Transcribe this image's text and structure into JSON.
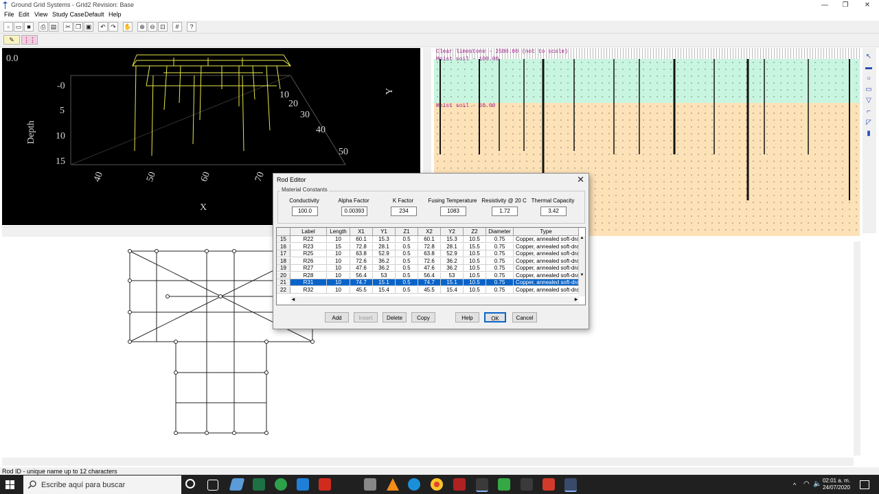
{
  "window": {
    "title": "Ground Grid Systems - Grid2    Revision: Base"
  },
  "menus": [
    "File",
    "Edit",
    "View",
    "Study Case",
    "Default",
    "Help"
  ],
  "view3d": {
    "top_value": "0.0",
    "depth_label": "Depth",
    "depth_ticks": [
      "-0",
      "5",
      "10",
      "15"
    ],
    "x_label": "X",
    "x_ticks": [
      "40",
      "50",
      "60",
      "70"
    ],
    "y_label": "Y",
    "y_ticks": [
      "10",
      "20",
      "30",
      "40",
      "50"
    ]
  },
  "soil": {
    "top_layer": "Clear limestone - 2500.00   (not to scale)",
    "layer1": "Moist soil - 100.00",
    "layer2": "Moist soil - 60.00"
  },
  "status": {
    "text": "Rod ID - unique name up to 12 characters"
  },
  "dialog": {
    "title": "Rod Editor",
    "group_label": "Material Constants",
    "constants": [
      {
        "label": "Conductivity",
        "value": "100.0"
      },
      {
        "label": "Alpha Factor",
        "value": "0.00393"
      },
      {
        "label": "K Factor",
        "value": "234"
      },
      {
        "label": "Fusing Temperature",
        "value": "1083"
      },
      {
        "label": "Resistivity @ 20 C",
        "value": "1.72"
      },
      {
        "label": "Thermal Capacity",
        "value": "3.42"
      }
    ],
    "columns": [
      "Label",
      "Length",
      "X1",
      "Y1",
      "Z1",
      "X2",
      "Y2",
      "Z2",
      "Diameter",
      "Type"
    ],
    "rows": [
      {
        "n": "15",
        "cells": [
          "R22",
          "10",
          "60.1",
          "15.3",
          "0.5",
          "60.1",
          "15.3",
          "10.5",
          "0.75",
          "Copper, annealed soft-drawn"
        ]
      },
      {
        "n": "16",
        "cells": [
          "R23",
          "15",
          "72.8",
          "28.1",
          "0.5",
          "72.8",
          "28.1",
          "15.5",
          "0.75",
          "Copper, annealed soft-drawn"
        ]
      },
      {
        "n": "17",
        "cells": [
          "R25",
          "10",
          "63.8",
          "52.9",
          "0.5",
          "63.8",
          "52.9",
          "10.5",
          "0.75",
          "Copper, annealed soft-drawn"
        ]
      },
      {
        "n": "18",
        "cells": [
          "R26",
          "10",
          "72.6",
          "36.2",
          "0.5",
          "72.6",
          "36.2",
          "10.5",
          "0.75",
          "Copper, annealed soft-drawn"
        ]
      },
      {
        "n": "19",
        "cells": [
          "R27",
          "10",
          "47.6",
          "36.2",
          "0.5",
          "47.6",
          "36.2",
          "10.5",
          "0.75",
          "Copper, annealed soft-drawn"
        ]
      },
      {
        "n": "20",
        "cells": [
          "R28",
          "10",
          "56.4",
          "53",
          "0.5",
          "56.4",
          "53",
          "10.5",
          "0.75",
          "Copper, annealed soft-drawn"
        ]
      },
      {
        "n": "21",
        "cells": [
          "R31",
          "10",
          "74.7",
          "15.1",
          "0.5",
          "74.7",
          "15.1",
          "10.5",
          "0.75",
          "Copper, annealed soft-drawn"
        ]
      },
      {
        "n": "22",
        "cells": [
          "R32",
          "10",
          "45.5",
          "15.4",
          "0.5",
          "45.5",
          "15.4",
          "10.5",
          "0.75",
          "Copper, annealed soft-drawn"
        ]
      }
    ],
    "selected_row": "21",
    "buttons": {
      "add": "Add",
      "insert": "Insert",
      "delete": "Delete",
      "copy": "Copy",
      "help": "Help",
      "ok": "OK",
      "cancel": "Cancel"
    }
  },
  "taskbar": {
    "search_placeholder": "Escribe aquí para buscar",
    "time": "02:01 a. m.",
    "date": "24/07/2020"
  },
  "colors": {
    "selected": "#0a64c8",
    "soil_top": "#c8f5e0",
    "soil_bottom": "#fde2b8",
    "grid3d": "#e8e84a"
  }
}
